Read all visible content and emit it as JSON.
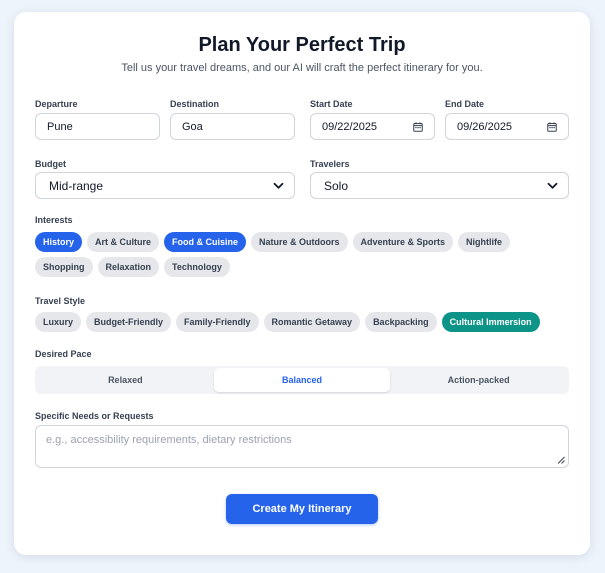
{
  "header": {
    "title": "Plan Your Perfect Trip",
    "subtitle": "Tell us your travel dreams, and our AI will craft the perfect itinerary for you."
  },
  "fields": {
    "departure": {
      "label": "Departure",
      "value": "Pune"
    },
    "destination": {
      "label": "Destination",
      "value": "Goa"
    },
    "start_date": {
      "label": "Start Date",
      "value": "09/22/2025"
    },
    "end_date": {
      "label": "End Date",
      "value": "09/26/2025"
    },
    "budget": {
      "label": "Budget",
      "value": "Mid-range"
    },
    "travelers": {
      "label": "Travelers",
      "value": "Solo"
    }
  },
  "interests": {
    "label": "Interests",
    "items": [
      {
        "label": "History",
        "selected": true
      },
      {
        "label": "Art & Culture",
        "selected": false
      },
      {
        "label": "Food & Cuisine",
        "selected": true
      },
      {
        "label": "Nature & Outdoors",
        "selected": false
      },
      {
        "label": "Adventure & Sports",
        "selected": false
      },
      {
        "label": "Nightlife",
        "selected": false
      },
      {
        "label": "Shopping",
        "selected": false
      },
      {
        "label": "Relaxation",
        "selected": false
      },
      {
        "label": "Technology",
        "selected": false
      }
    ]
  },
  "travel_style": {
    "label": "Travel Style",
    "items": [
      {
        "label": "Luxury",
        "selected": false
      },
      {
        "label": "Budget-Friendly",
        "selected": false
      },
      {
        "label": "Family-Friendly",
        "selected": false
      },
      {
        "label": "Romantic Getaway",
        "selected": false
      },
      {
        "label": "Backpacking",
        "selected": false
      },
      {
        "label": "Cultural Immersion",
        "selected": true
      }
    ]
  },
  "pace": {
    "label": "Desired Pace",
    "options": [
      "Relaxed",
      "Balanced",
      "Action-packed"
    ],
    "selected": "Balanced"
  },
  "requests": {
    "label": "Specific Needs or Requests",
    "placeholder": "e.g., accessibility requirements, dietary restrictions"
  },
  "submit": {
    "label": "Create My Itinerary"
  },
  "icons": {
    "date": "calendar-icon",
    "select": "chevron-down-icon",
    "resize": "resize-grip-icon"
  },
  "colors": {
    "primary": "#2563eb",
    "teal": "#0d9488",
    "chip_bg": "#e5e7eb",
    "page_bg": "#eef4fb"
  }
}
